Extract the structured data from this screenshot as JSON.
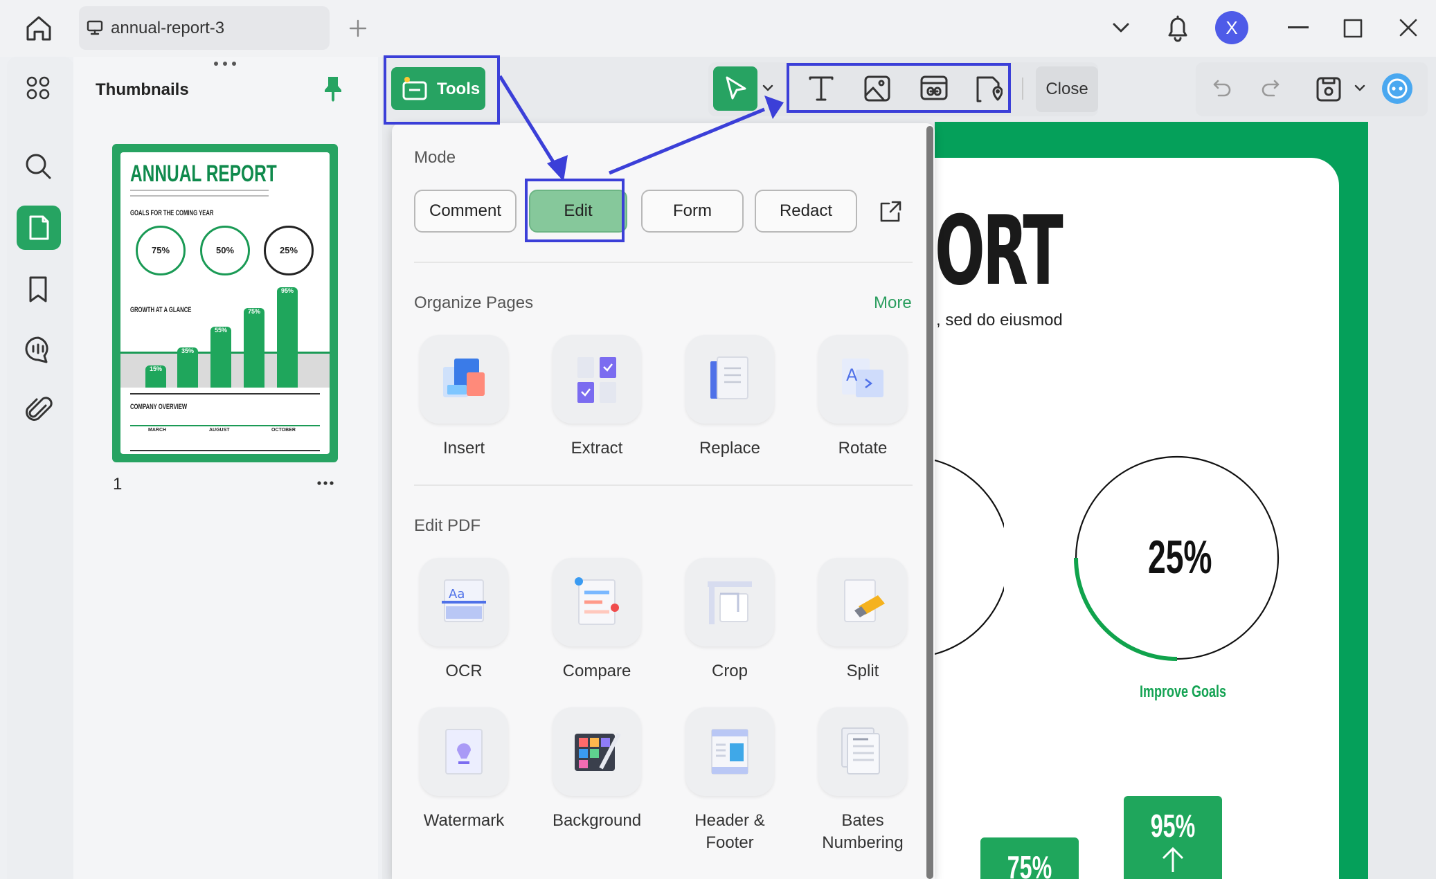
{
  "window": {
    "tab_title": "annual-report-3",
    "avatar_letter": "X"
  },
  "thumbnails": {
    "title": "Thumbnails",
    "page_number": "1"
  },
  "thumbnail_page": {
    "title": "ANNUAL REPORT",
    "goals_heading": "GOALS FOR THE COMING YEAR",
    "goals": [
      "75%",
      "50%",
      "25%"
    ],
    "growth_heading": "GROWTH AT A GLANCE",
    "bars": [
      "15%",
      "35%",
      "55%",
      "75%",
      "95%"
    ],
    "overview_heading": "COMPANY OVERVIEW",
    "milestones": [
      "MARCH",
      "AUGUST",
      "OCTOBER"
    ]
  },
  "toolbar": {
    "tools_label": "Tools",
    "close_label": "Close"
  },
  "document": {
    "title_fragment": "ORT",
    "subtitle_fragment": ", sed do eiusmod",
    "circle_value": "25%",
    "circle_caption": "Improve Goals",
    "bar_tall": "95%",
    "bar_short": "75%"
  },
  "dropdown": {
    "mode_heading": "Mode",
    "modes": [
      "Comment",
      "Edit",
      "Form",
      "Redact"
    ],
    "organize_heading": "Organize Pages",
    "more_label": "More",
    "organize_tools": [
      "Insert",
      "Extract",
      "Replace",
      "Rotate"
    ],
    "edit_heading": "Edit PDF",
    "edit_tools_row1": [
      "OCR",
      "Compare",
      "Crop",
      "Split"
    ],
    "edit_tools_row2": [
      "Watermark",
      "Background",
      "Header &\nFooter",
      "Bates\nNumbering"
    ]
  },
  "colors": {
    "accent": "#27a362",
    "highlight": "#3b3fd8"
  }
}
